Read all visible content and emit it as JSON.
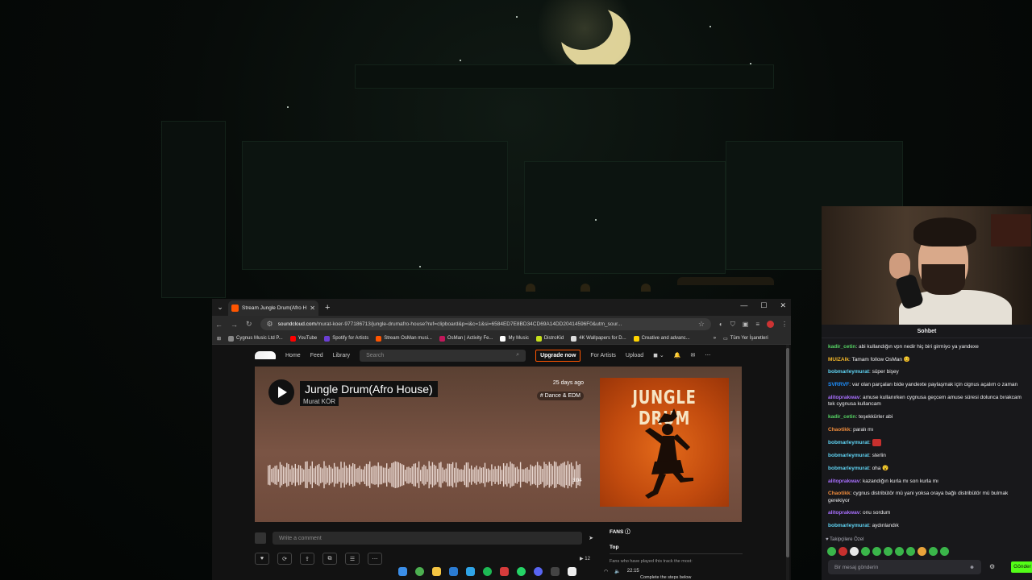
{
  "browser": {
    "tab_title": "Stream Jungle Drum(Afro House",
    "url_host": "soundcloud.com",
    "url_path": "/murat-koer-977186713/jungle-drumafro-house?ref=clipboard&p=i&c=1&si=6584ED7E8BD34CD69A14DD20414596F0&utm_sour...",
    "bookmarks": [
      {
        "label": "Cygnus Music Ltd P...",
        "color": "#888888"
      },
      {
        "label": "YouTube",
        "color": "#ff0000"
      },
      {
        "label": "Spotify for Artists",
        "color": "#6b3fd4"
      },
      {
        "label": "Stream OsMan musi...",
        "color": "#ff5500"
      },
      {
        "label": "OsMan | Activity Fe...",
        "color": "#c2185b"
      },
      {
        "label": "My Music",
        "color": "#ffffff"
      },
      {
        "label": "DistroKid",
        "color": "#c6e01c"
      },
      {
        "label": "4K Wallpapers for D...",
        "color": "#dddddd"
      },
      {
        "label": "Creative and advanc...",
        "color": "#ffd400"
      }
    ],
    "bookmarks_all": "Tüm Yer İşaretleri"
  },
  "soundcloud": {
    "nav": {
      "home": "Home",
      "feed": "Feed",
      "library": "Library",
      "search_placeholder": "Search",
      "upgrade": "Upgrade now",
      "for_artists": "For Artists",
      "upload": "Upload"
    },
    "track": {
      "title": "Jungle Drum(Afro House)",
      "artist": "Murat KÖR",
      "posted": "25 days ago",
      "genre": "# Dance & EDM",
      "duration": "3:04",
      "cover_text": "JUNGLE DRUM"
    },
    "comment_placeholder": "Write a comment",
    "play_count": "▶ 12",
    "fans": {
      "title": "FANS",
      "tab": "Top",
      "subtitle": "Fans who have played this track the most:",
      "cta": "Complete the steps below"
    }
  },
  "taskbar": {
    "time": "22:15"
  },
  "chat": {
    "header": "Sohbet",
    "messages": [
      {
        "user": "kadir_cetin",
        "color": "#56d364",
        "text": "abi kullandığın vpn nedir hiç biri girmiyo ya yandexe"
      },
      {
        "user": "MUIZAlk",
        "color": "#f0b429",
        "text": "Tamam follow OsMan 😊"
      },
      {
        "user": "bobmarleymurat",
        "color": "#5fd3f3",
        "text": "süper bişey"
      },
      {
        "user": "SVRRVF",
        "color": "#1e90ff",
        "text": "var olan parçaları bide yandexte paylaşmak için cignus açalım o zaman"
      },
      {
        "user": "alitoprakwav",
        "color": "#a970ff",
        "text": "amuse kullanırken cygnusa geçcem amuse süresi dolunca bırakcam tek cygnusa kullancam"
      },
      {
        "user": "kadir_cetin",
        "color": "#56d364",
        "text": "teşekkürler abi"
      },
      {
        "user": "Chaotikk",
        "color": "#f08c3c",
        "text": "paralı mı"
      },
      {
        "user": "bobmarleymurat",
        "color": "#5fd3f3",
        "text": ""
      },
      {
        "user": "bobmarleymurat",
        "color": "#5fd3f3",
        "text": "sterlin"
      },
      {
        "user": "bobmarleymurat",
        "color": "#5fd3f3",
        "text": "oha 😮"
      },
      {
        "user": "alitoprakwav",
        "color": "#a970ff",
        "text": "kazandığın kurla mı son kurla mı"
      },
      {
        "user": "Chaotikk",
        "color": "#f08c3c",
        "text": "cygnus distribütör mü yani yoksa oraya bağlı distribütör mü bulmak gerekiyor"
      },
      {
        "user": "alitoprakwav",
        "color": "#a970ff",
        "text": "onu sordum"
      },
      {
        "user": "bobmarleymurat",
        "color": "#5fd3f3",
        "text": "aydınlandık"
      }
    ],
    "followers_label": "♥ Takipçilere Özel",
    "input_placeholder": "Bir mesaj gönderin",
    "send_label": "Gönder"
  }
}
